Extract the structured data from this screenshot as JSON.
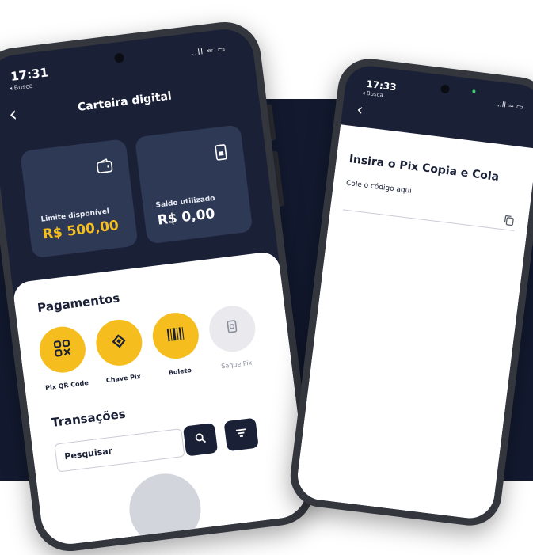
{
  "phone_left": {
    "status": {
      "time": "17:31",
      "back_app": "◂ Busca",
      "signal": "..ll ≈ ▭"
    },
    "header": {
      "back_icon": "chevron-left",
      "title": "Carteira digital"
    },
    "cards": [
      {
        "icon": "wallet-icon",
        "label": "Limite disponível",
        "value": "R$ 500,00",
        "value_color": "#f5be1e"
      },
      {
        "icon": "receipt-phone-icon",
        "label": "Saldo utilizado",
        "value": "R$ 0,00",
        "value_color": "#ffffff"
      }
    ],
    "payments": {
      "title": "Pagamentos",
      "items": [
        {
          "label": "Pix QR Code",
          "icon": "qr-code-icon",
          "enabled": true
        },
        {
          "label": "Chave Pix",
          "icon": "pix-diamond-icon",
          "enabled": true
        },
        {
          "label": "Boleto",
          "icon": "barcode-icon",
          "enabled": true
        },
        {
          "label": "Saque Pix",
          "icon": "hand-cash-icon",
          "enabled": false
        }
      ]
    },
    "transactions": {
      "title": "Transações",
      "search_placeholder": "Pesquisar",
      "search_icon": "magnifier-icon",
      "filter_icon": "filter-icon"
    }
  },
  "phone_right": {
    "status": {
      "time": "17:33",
      "back_app": "◂ Busca",
      "signal": "..ll ≈ ▭"
    },
    "header": {
      "back_icon": "chevron-left"
    },
    "pix": {
      "title": "Insira o Pix Copia e Cola",
      "input_placeholder": "Cole o código aqui",
      "paste_icon": "copy-icon"
    }
  },
  "colors": {
    "navy": "#1a2036",
    "gold": "#f5be1e",
    "card": "#2e3956"
  }
}
